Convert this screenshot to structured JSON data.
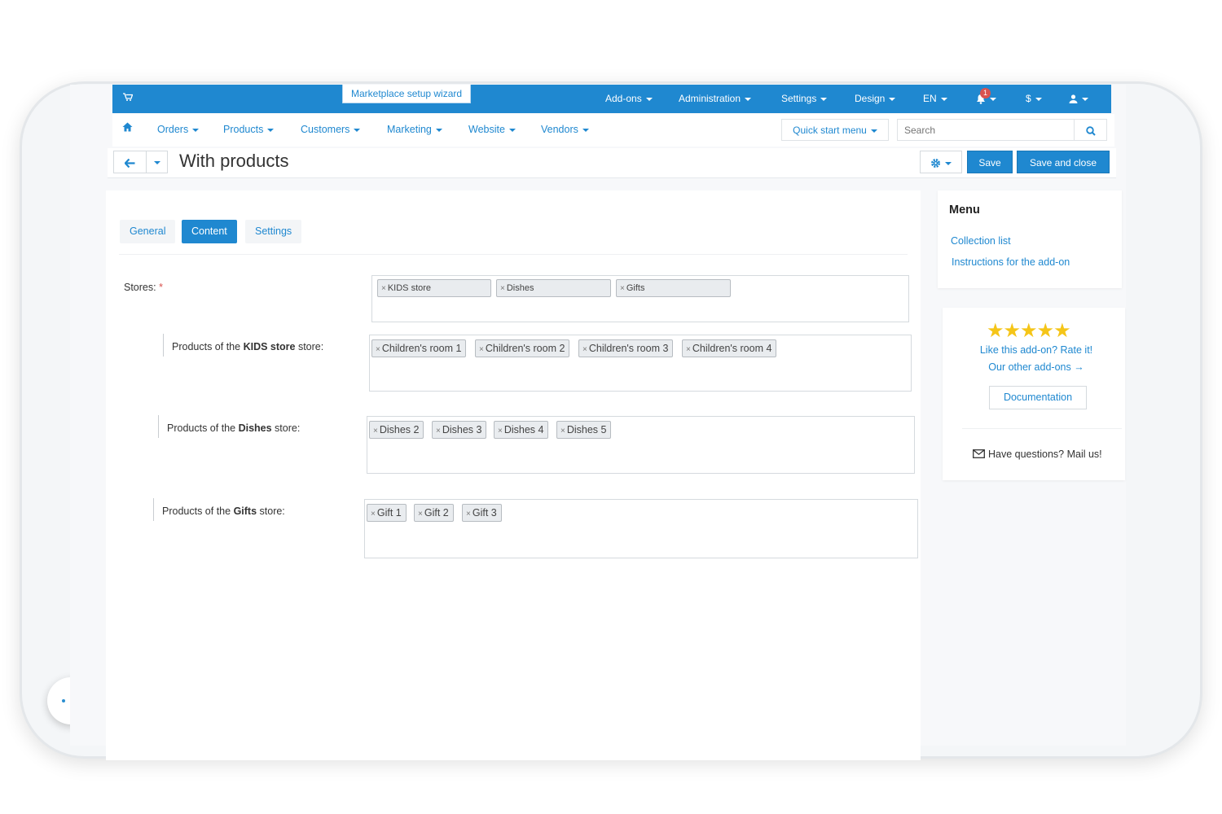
{
  "topbar": {
    "wizard_label": "Marketplace setup wizard",
    "menus": [
      "Add-ons",
      "Administration",
      "Settings",
      "Design",
      "EN"
    ],
    "notification_count": "1",
    "currency_label": "$"
  },
  "nav": {
    "items": [
      "Orders",
      "Products",
      "Customers",
      "Marketing",
      "Website",
      "Vendors"
    ],
    "quick_start": "Quick start menu",
    "search_placeholder": "Search"
  },
  "titlebar": {
    "title": "With products",
    "save": "Save",
    "save_close": "Save and close"
  },
  "tabs": [
    "General",
    "Content",
    "Settings"
  ],
  "form": {
    "stores_label": "Stores:",
    "required_mark": "*",
    "stores": [
      "KIDS store",
      "Dishes",
      "Gifts"
    ],
    "groups": [
      {
        "prefix": "Products of the ",
        "store": "KIDS store",
        "suffix": " store:",
        "items": [
          "Children's room 1",
          "Children's room 2",
          "Children's room 3",
          "Children's room 4"
        ]
      },
      {
        "prefix": "Products of the ",
        "store": "Dishes",
        "suffix": " store:",
        "items": [
          "Dishes 2",
          "Dishes 3",
          "Dishes 4",
          "Dishes 5"
        ]
      },
      {
        "prefix": "Products of the ",
        "store": "Gifts",
        "suffix": " store:",
        "items": [
          "Gift 1",
          "Gift 2",
          "Gift 3"
        ]
      }
    ],
    "remove_glyph": "×"
  },
  "sidebar": {
    "menu_title": "Menu",
    "links": [
      "Collection list",
      "Instructions for the add-on"
    ],
    "stars": "★★★★★",
    "rate_text": "Like this add-on? Rate it!",
    "other_addons": "Our other add-ons →",
    "documentation": "Documentation",
    "mail_text": "Have questions? Mail us!"
  },
  "colors": {
    "accent": "#1f88d0",
    "star": "#f5c518",
    "badge": "#d9534f"
  }
}
